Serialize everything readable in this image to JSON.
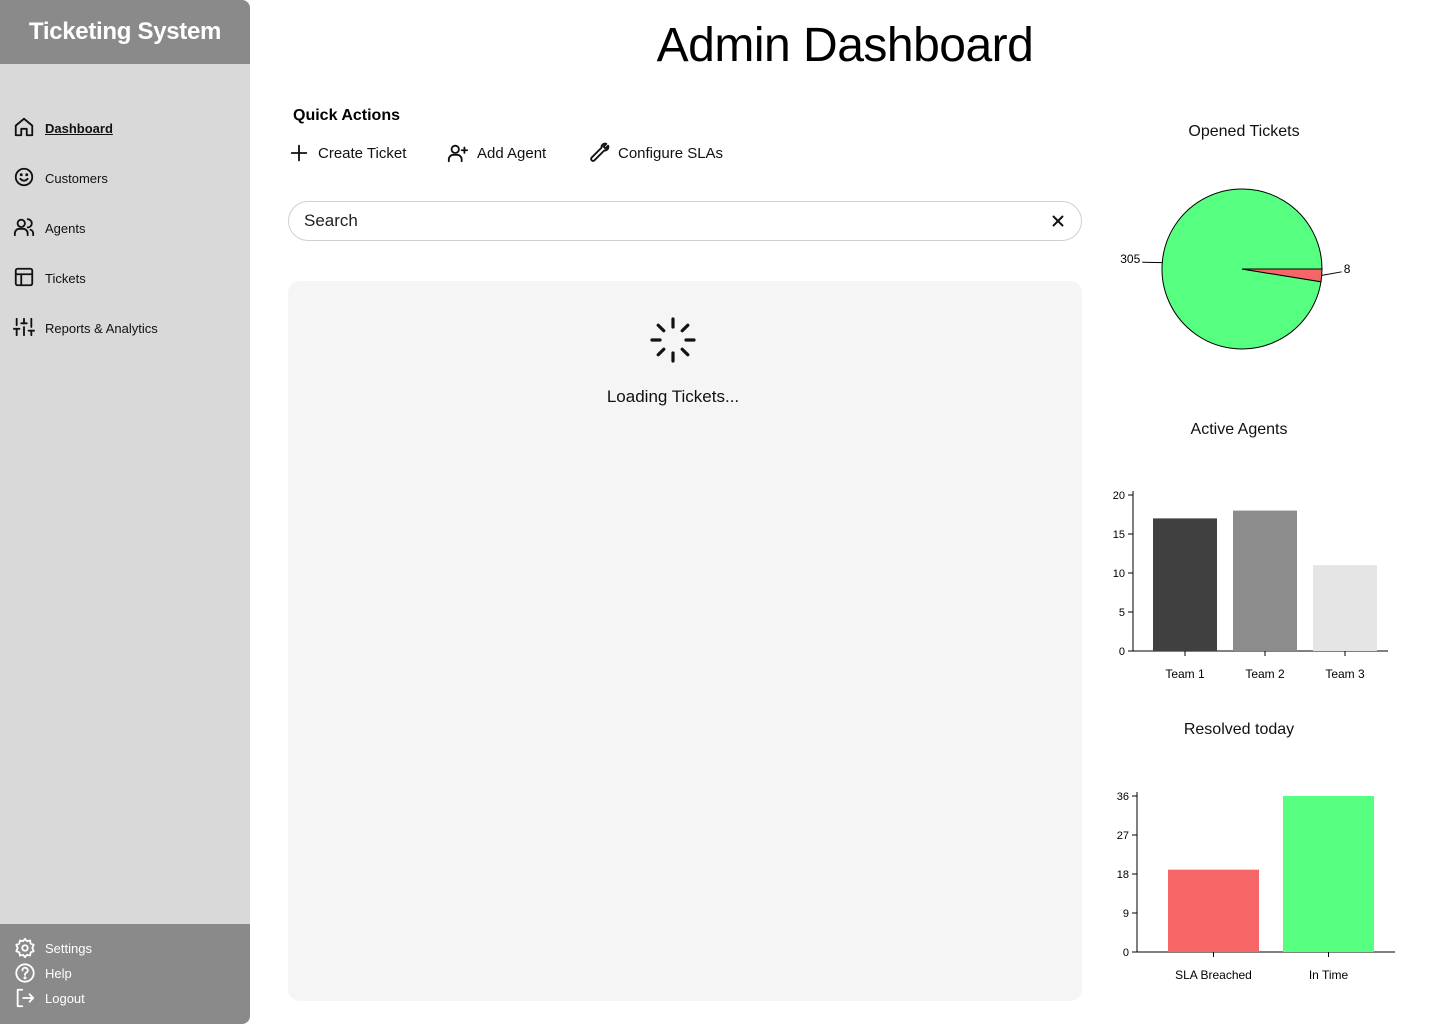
{
  "app": {
    "title": "Ticketing System"
  },
  "sidebar": {
    "items": [
      {
        "label": "Dashboard",
        "icon": "home-icon",
        "active": true
      },
      {
        "label": "Customers",
        "icon": "smiley-icon",
        "active": false
      },
      {
        "label": "Agents",
        "icon": "users-icon",
        "active": false
      },
      {
        "label": "Tickets",
        "icon": "table-icon",
        "active": false
      },
      {
        "label": "Reports & Analytics",
        "icon": "sliders-icon",
        "active": false
      }
    ],
    "footer": [
      {
        "label": "Settings",
        "icon": "gear-icon"
      },
      {
        "label": "Help",
        "icon": "help-circle-icon"
      },
      {
        "label": "Logout",
        "icon": "logout-icon"
      }
    ]
  },
  "header": {
    "title": "Admin Dashboard"
  },
  "quick_actions": {
    "title": "Quick Actions",
    "buttons": [
      {
        "label": "Create Ticket",
        "icon": "plus-icon"
      },
      {
        "label": "Add Agent",
        "icon": "user-plus-icon"
      },
      {
        "label": "Configure SLAs",
        "icon": "wrench-icon"
      }
    ]
  },
  "search": {
    "placeholder": "Search",
    "value": ""
  },
  "tickets": {
    "loading_text": "Loading Tickets..."
  },
  "colors": {
    "sidebar_bg": "#d9d9d9",
    "sidebar_header_bg": "#8a8a8a",
    "green": "#57ff80",
    "red": "#f76666",
    "dark_gray": "#404040",
    "mid_gray": "#8c8c8c",
    "light_gray": "#e5e5e5"
  },
  "chart_data": [
    {
      "type": "pie",
      "title": "Opened Tickets",
      "values": [
        305,
        8
      ],
      "labels": [
        "305",
        "8"
      ],
      "colors": [
        "#57ff80",
        "#f76666"
      ]
    },
    {
      "type": "bar",
      "title": "Active Agents",
      "categories": [
        "Team 1",
        "Team 2",
        "Team 3"
      ],
      "values": [
        17,
        18,
        11
      ],
      "colors": [
        "#404040",
        "#8c8c8c",
        "#e5e5e5"
      ],
      "ylim": [
        0,
        20
      ],
      "yticks": [
        0,
        5,
        10,
        15,
        20
      ]
    },
    {
      "type": "bar",
      "title": "Resolved today",
      "categories": [
        "SLA Breached",
        "In Time"
      ],
      "values": [
        19,
        36
      ],
      "colors": [
        "#f76666",
        "#57ff80"
      ],
      "ylim": [
        0,
        36
      ],
      "yticks": [
        0,
        9,
        18,
        27,
        36
      ]
    }
  ]
}
